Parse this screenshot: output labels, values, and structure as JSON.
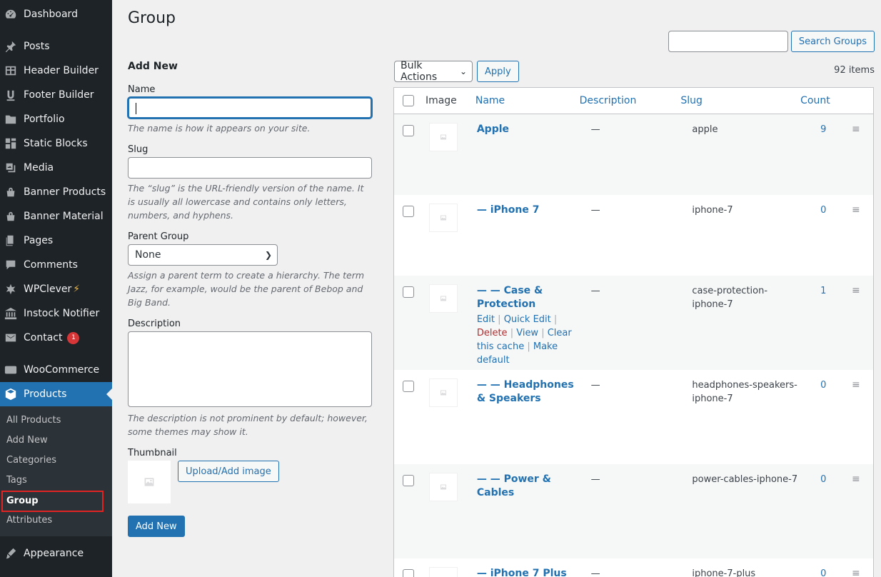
{
  "sidebar": {
    "top": [
      {
        "label": "Dashboard",
        "icon": "dashboard-icon"
      }
    ],
    "items": [
      {
        "label": "Posts",
        "icon": "pin-icon"
      },
      {
        "label": "Header Builder",
        "icon": "table-icon"
      },
      {
        "label": "Footer Builder",
        "icon": "u-icon"
      },
      {
        "label": "Portfolio",
        "icon": "folder-icon"
      },
      {
        "label": "Static Blocks",
        "icon": "blocks-icon"
      },
      {
        "label": "Media",
        "icon": "media-icon"
      },
      {
        "label": "Banner Products",
        "icon": "cart-icon"
      },
      {
        "label": "Banner Material",
        "icon": "cart-icon"
      },
      {
        "label": "Pages",
        "icon": "pages-icon"
      },
      {
        "label": "Comments",
        "icon": "comment-icon"
      },
      {
        "label": "WPClever",
        "icon": "wpclever-icon",
        "bolt": "⚡"
      },
      {
        "label": "Instock Notifier",
        "icon": "bank-icon"
      },
      {
        "label": "Contact",
        "icon": "mail-icon",
        "badge": "1"
      }
    ],
    "woocommerce": {
      "label": "WooCommerce",
      "icon": "woo-icon"
    },
    "products": {
      "label": "Products",
      "icon": "box-icon"
    },
    "submenu": [
      "All Products",
      "Add New",
      "Categories",
      "Tags",
      "Group",
      "Attributes"
    ],
    "appearance": {
      "label": "Appearance",
      "icon": "brush-icon"
    }
  },
  "page": {
    "title": "Group"
  },
  "search": {
    "button": "Search Groups",
    "value": ""
  },
  "form": {
    "heading": "Add New",
    "name_label": "Name",
    "name_help": "The name is how it appears on your site.",
    "slug_label": "Slug",
    "slug_help": "The “slug” is the URL-friendly version of the name. It is usually all lowercase and contains only letters, numbers, and hyphens.",
    "parent_label": "Parent Group",
    "parent_value": "None",
    "parent_help": "Assign a parent term to create a hierarchy. The term Jazz, for example, would be the parent of Bebop and Big Band.",
    "desc_label": "Description",
    "desc_help": "The description is not prominent by default; however, some themes may show it.",
    "thumb_label": "Thumbnail",
    "upload_button": "Upload/Add image",
    "submit_button": "Add New"
  },
  "list": {
    "bulk_label": "Bulk Actions",
    "apply_label": "Apply",
    "items_count": "92 items",
    "columns": {
      "image": "Image",
      "name": "Name",
      "description": "Description",
      "slug": "Slug",
      "count": "Count"
    },
    "rows": [
      {
        "name": "Apple",
        "description": "—",
        "slug": "apple",
        "count": "9"
      },
      {
        "name": "— iPhone 7",
        "description": "—",
        "slug": "iphone-7",
        "count": "0"
      },
      {
        "name": "— — Case & Protection",
        "description": "—",
        "slug": "case-protection-iphone-7",
        "count": "1",
        "actions": {
          "edit": "Edit",
          "quick_edit": "Quick Edit",
          "delete": "Delete",
          "view": "View",
          "clear_cache": "Clear this cache",
          "make_default": "Make default"
        }
      },
      {
        "name": "— — Headphones & Speakers",
        "description": "—",
        "slug": "headphones-speakers-iphone-7",
        "count": "0"
      },
      {
        "name": "— — Power & Cables",
        "description": "—",
        "slug": "power-cables-iphone-7",
        "count": "0"
      },
      {
        "name": "— iPhone 7 Plus",
        "description": "—",
        "slug": "iphone-7-plus",
        "count": "0"
      }
    ]
  },
  "colors": {
    "accent": "#2271b1",
    "sidebar_bg": "#1d2327",
    "highlight_border": "#e02424",
    "delete": "#b32d2e"
  }
}
